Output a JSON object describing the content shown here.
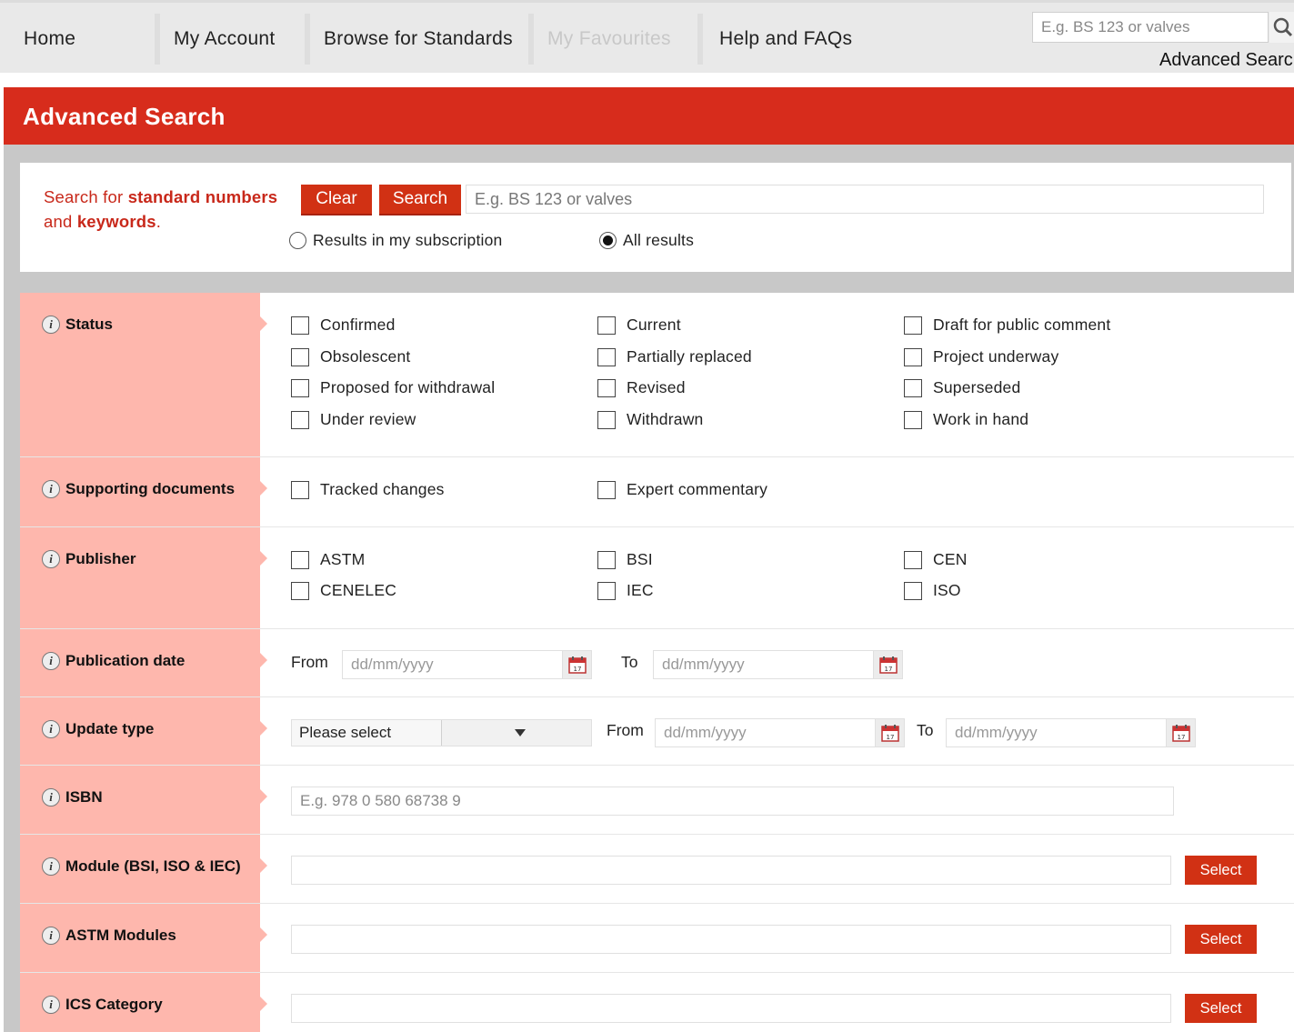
{
  "nav": {
    "items": [
      {
        "label": "Home",
        "enabled": true
      },
      {
        "label": "My Account",
        "enabled": true
      },
      {
        "label": "Browse for Standards",
        "enabled": true
      },
      {
        "label": "My Favourites",
        "enabled": false
      },
      {
        "label": "Help and FAQs",
        "enabled": true
      }
    ],
    "search_placeholder": "E.g. BS 123 or valves",
    "advanced_link": "Advanced Search"
  },
  "page": {
    "title": "Advanced Search"
  },
  "search": {
    "lead_prefix": "Search for ",
    "lead_bold1": "standard numbers",
    "lead_mid": " and ",
    "lead_bold2": "keywords",
    "lead_suffix": ".",
    "clear_label": "Clear",
    "search_label": "Search",
    "placeholder": "E.g. BS 123 or valves",
    "scope_options": [
      {
        "label": "Results in my subscription",
        "selected": false
      },
      {
        "label": "All results",
        "selected": true
      }
    ]
  },
  "filters": {
    "status": {
      "label": "Status",
      "options": [
        "Confirmed",
        "Current",
        "Draft for public comment",
        "Obsolescent",
        "Partially replaced",
        "Project underway",
        "Proposed for withdrawal",
        "Revised",
        "Superseded",
        "Under review",
        "Withdrawn",
        "Work in hand"
      ]
    },
    "supporting": {
      "label": "Supporting documents",
      "options": [
        "Tracked changes",
        "Expert commentary"
      ]
    },
    "publisher": {
      "label": "Publisher",
      "options": [
        "ASTM",
        "BSI",
        "CEN",
        "CENELEC",
        "IEC",
        "ISO"
      ]
    },
    "publication_date": {
      "label": "Publication date",
      "from_label": "From",
      "to_label": "To",
      "date_placeholder": "dd/mm/yyyy"
    },
    "update_type": {
      "label": "Update type",
      "select_value": "Please select",
      "from_label": "From",
      "to_label": "To",
      "date_placeholder": "dd/mm/yyyy"
    },
    "isbn": {
      "label": "ISBN",
      "placeholder": "E.g. 978 0 580 68738 9"
    },
    "module": {
      "label": "Module (BSI, ISO & IEC)",
      "button": "Select"
    },
    "astm": {
      "label": "ASTM Modules",
      "button": "Select"
    },
    "ics": {
      "label": "ICS Category",
      "button": "Select"
    }
  },
  "colors": {
    "brand_red": "#d72c1c",
    "label_pink": "#feb7ad",
    "frame_grey": "#c8c8c8"
  }
}
